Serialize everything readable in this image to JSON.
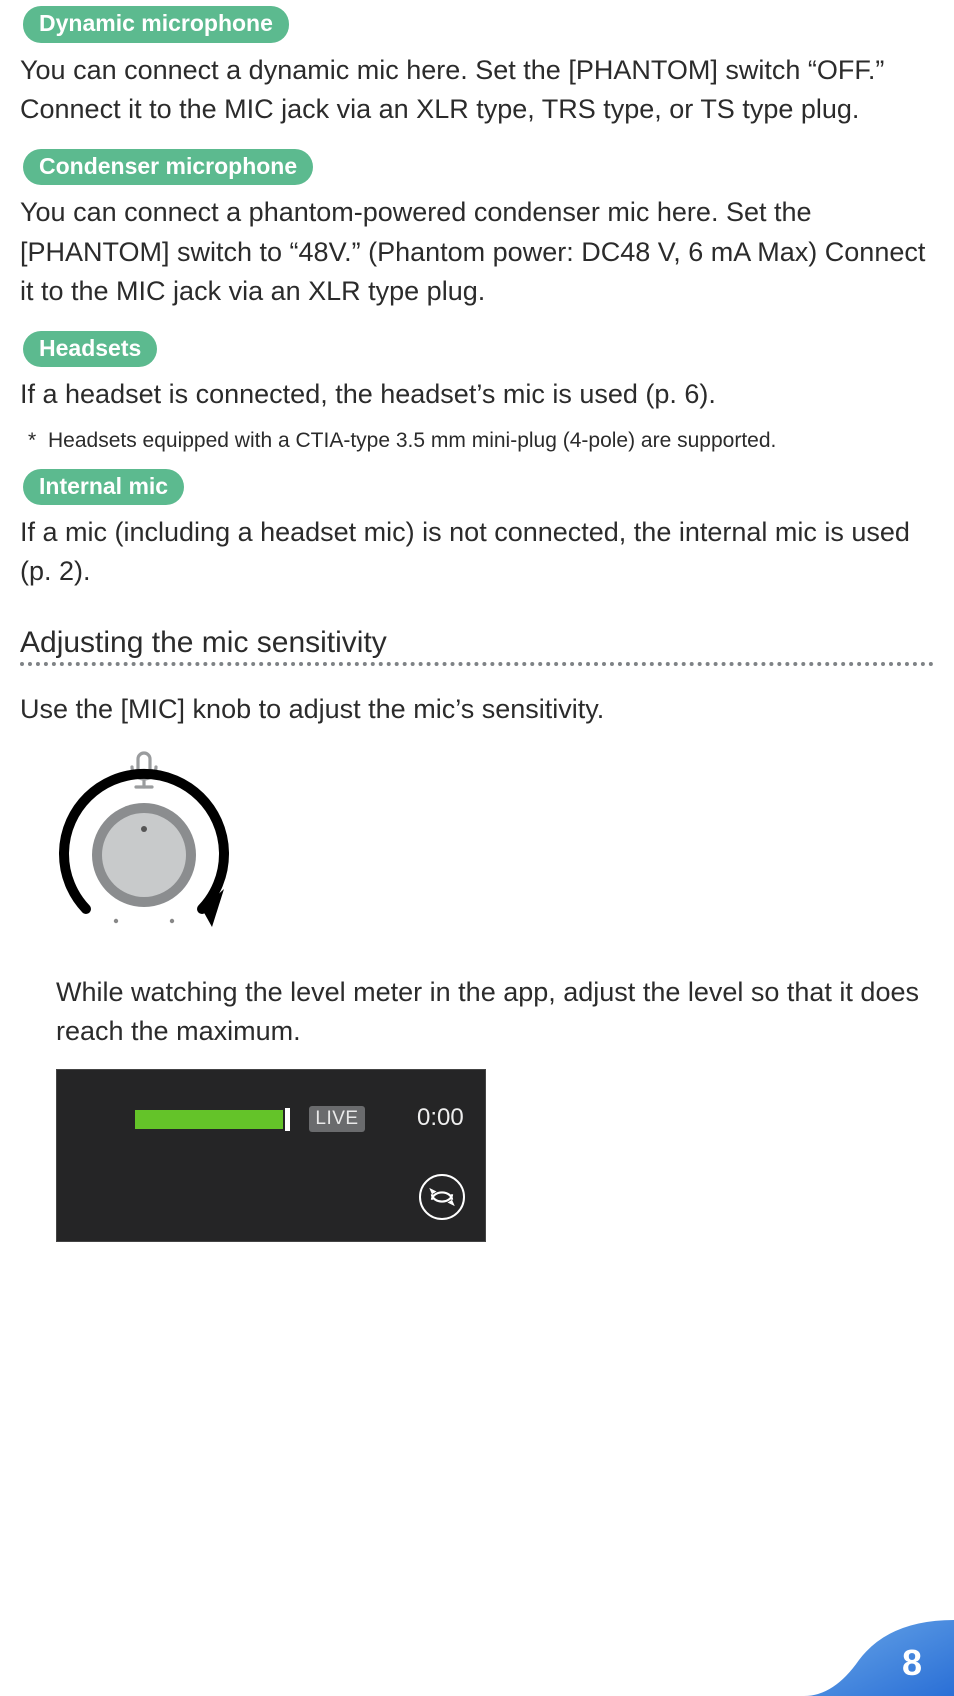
{
  "tags": {
    "dynamic": "Dynamic microphone",
    "condenser": "Condenser microphone",
    "headsets": "Headsets",
    "internal": "Internal mic"
  },
  "paragraphs": {
    "dynamic": "You can connect a dynamic mic here. Set the [PHANTOM] switch “OFF.” Connect it to the MIC jack via an XLR type, TRS type, or TS type plug.",
    "condenser": "You can connect a phantom-powered condenser mic here. Set the [PHANTOM] switch to “48V.” (Phantom power: DC48 V, 6 mA Max) Connect it to the MIC jack via an XLR type plug.",
    "headsets": "If a headset is connected, the headset’s mic is used (p. 6).",
    "headsets_note": "Headsets equipped with a CTIA-type 3.5 mm mini-plug (4-pole) are supported.",
    "internal": "If a mic (including a headset mic) is not connected, the internal mic is used (p. 2)."
  },
  "note_star": "*",
  "heading": "Adjusting the mic sensitivity",
  "adjust_intro": "Use the [MIC] knob to adjust the mic’s sensitivity.",
  "adjust_body": "While watching the level meter in the app, adjust the level so that it does reach the maximum.",
  "app": {
    "live": "LIVE",
    "timer": "0:00"
  },
  "page_number": "8"
}
